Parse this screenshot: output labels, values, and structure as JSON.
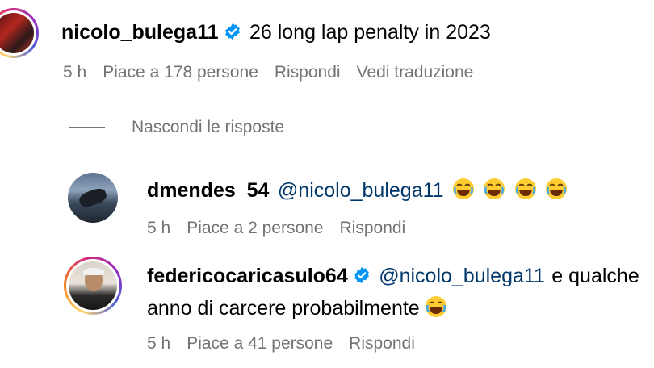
{
  "comments": [
    {
      "username": "nicolo_bulega11",
      "verified": true,
      "text": "26 long lap penalty in 2023",
      "time": "5 h",
      "likes": "Piace a 178 persone",
      "reply": "Rispondi",
      "translate": "Vedi traduzione"
    }
  ],
  "replies_toggle": "Nascondi le risposte",
  "replies": [
    {
      "username": "dmendes_54",
      "verified": false,
      "mention": "@nicolo_bulega11",
      "emoji_count": 4,
      "time": "5 h",
      "likes": "Piace a 2 persone",
      "reply": "Rispondi"
    },
    {
      "username": "federicocaricasulo64",
      "verified": true,
      "mention": "@nicolo_bulega11",
      "text_line1": "e qualche",
      "text_line2": "anno di carcere probabilmente",
      "time": "5 h",
      "likes": "Piace a 41 persone",
      "reply": "Rispondi"
    }
  ],
  "colors": {
    "verified_blue": "#0095f6",
    "mention": "#00376b",
    "meta_gray": "#737373"
  }
}
